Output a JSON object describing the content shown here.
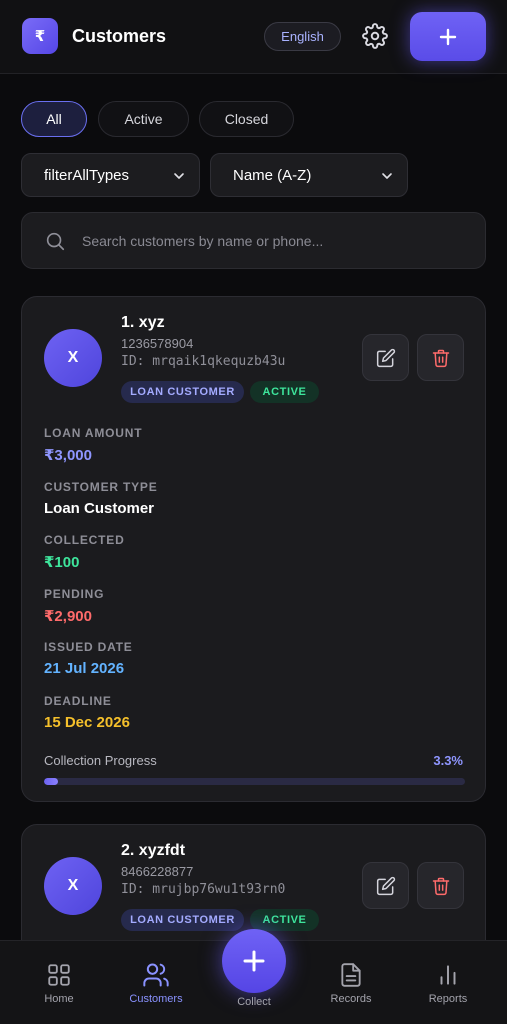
{
  "header": {
    "logo_symbol": "₹",
    "title": "Customers",
    "language": "English"
  },
  "tabs": [
    {
      "label": "All",
      "active": true
    },
    {
      "label": "Active",
      "active": false
    },
    {
      "label": "Closed",
      "active": false
    }
  ],
  "filters": {
    "type": "filterAllTypes",
    "sort": "Name (A-Z)"
  },
  "search": {
    "placeholder": "Search customers by name or phone..."
  },
  "field_labels": {
    "loan_amount": "LOAN AMOUNT",
    "customer_type": "CUSTOMER TYPE",
    "collected": "COLLECTED",
    "pending": "PENDING",
    "issued_date": "ISSUED DATE",
    "deadline": "DEADLINE",
    "progress": "Collection Progress"
  },
  "customers": [
    {
      "initial": "X",
      "name": "1. xyz",
      "phone": "1236578904",
      "id": "ID: mrqaik1qkequzb43u",
      "type_badge": "LOAN CUSTOMER",
      "status_badge": "ACTIVE",
      "loan_amount": "₹3,000",
      "customer_type": "Loan Customer",
      "collected": "₹100",
      "pending": "₹2,900",
      "issued_date": "21 Jul 2026",
      "deadline": "15 Dec 2026",
      "progress_pct": "3.3%",
      "progress_value": 3.3
    },
    {
      "initial": "X",
      "name": "2. xyzfdt",
      "phone": "8466228877",
      "id": "ID: mrujbp76wu1t93rn0",
      "type_badge": "LOAN CUSTOMER",
      "status_badge": "ACTIVE"
    }
  ],
  "nav": {
    "home": "Home",
    "customers": "Customers",
    "collect": "Collect",
    "records": "Records",
    "reports": "Reports"
  },
  "colors": {
    "accent": "#6c60f2",
    "loan_amount": "#8f96ff",
    "collected": "#3ee59c",
    "pending": "#ff6b6b",
    "issued_date": "#63b3ff",
    "deadline": "#f5c02b"
  },
  "icons": {
    "settings": "gear-icon",
    "add": "plus-icon",
    "search": "search-icon",
    "edit": "edit-icon",
    "delete": "trash-icon"
  }
}
